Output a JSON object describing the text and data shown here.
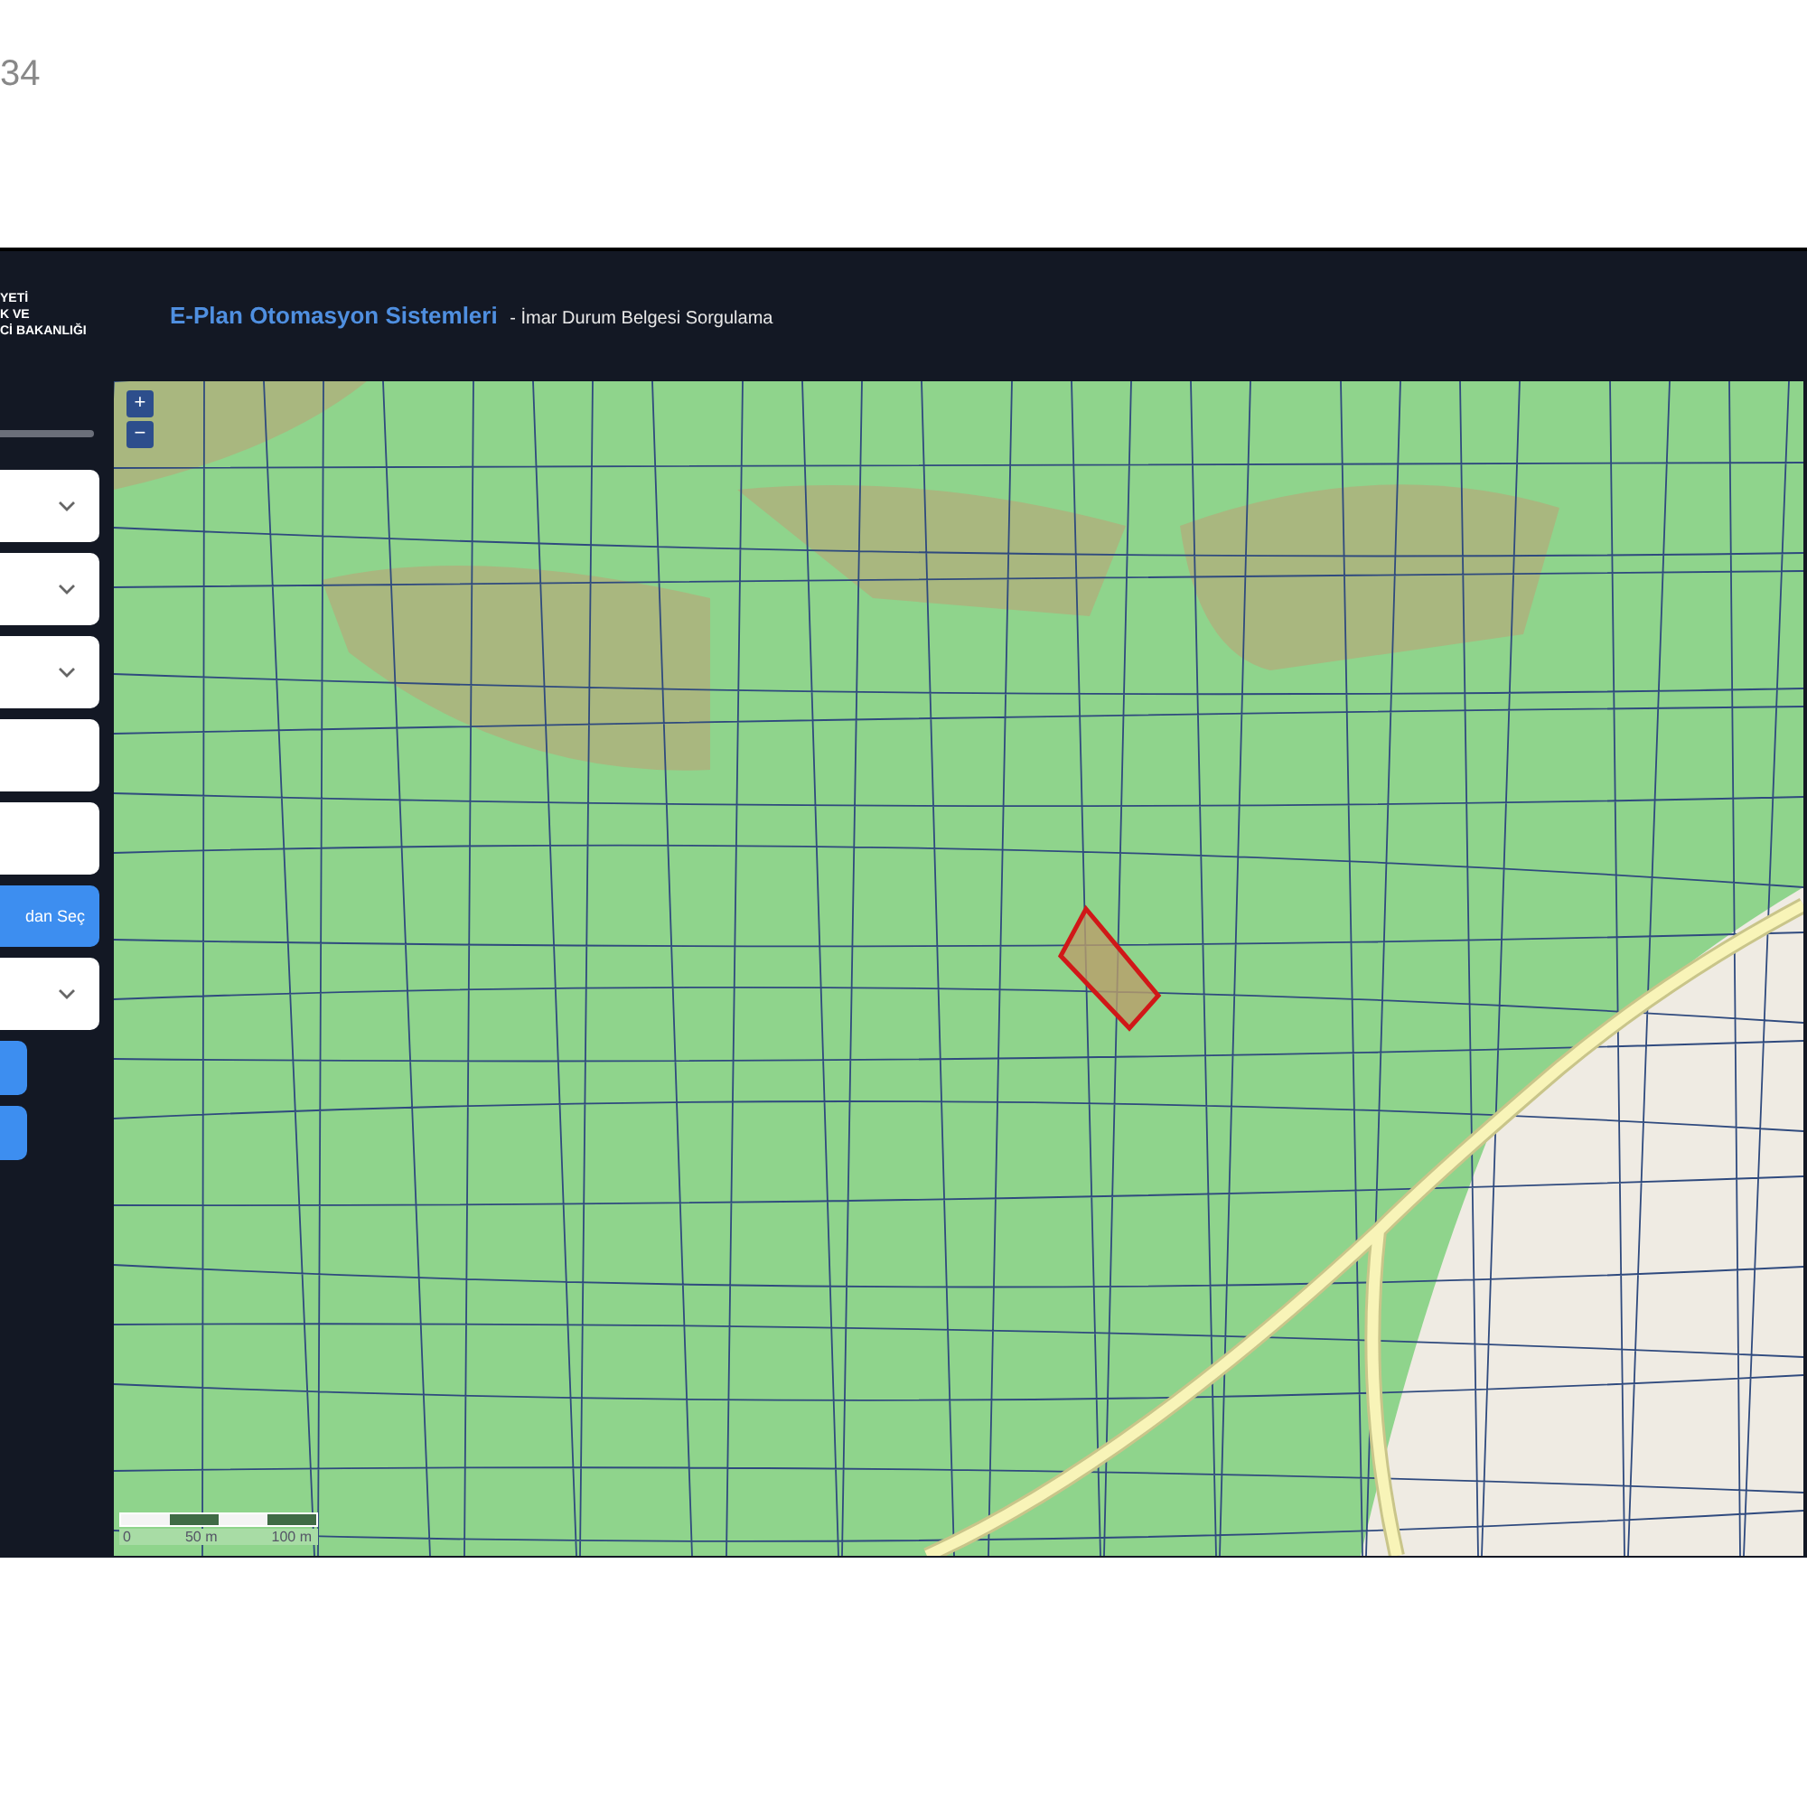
{
  "page": {
    "corner_text": "34"
  },
  "header": {
    "logo_lines": [
      "YETİ",
      "K VE",
      "Cİ BAKANLIĞI"
    ],
    "title": "E-Plan Otomasyon Sistemleri",
    "subtitle": "- İmar Durum Belgesi Sorgulama"
  },
  "sidebar": {
    "controls": [
      {
        "kind": "select"
      },
      {
        "kind": "select"
      },
      {
        "kind": "select"
      },
      {
        "kind": "input"
      },
      {
        "kind": "input"
      },
      {
        "kind": "button",
        "label": "dan Seç"
      },
      {
        "kind": "select"
      },
      {
        "kind": "small-button"
      },
      {
        "kind": "small-button"
      }
    ]
  },
  "map": {
    "zoom_in": "+",
    "zoom_out": "−",
    "scale_labels": [
      "0",
      "50 m",
      "100 m"
    ]
  }
}
